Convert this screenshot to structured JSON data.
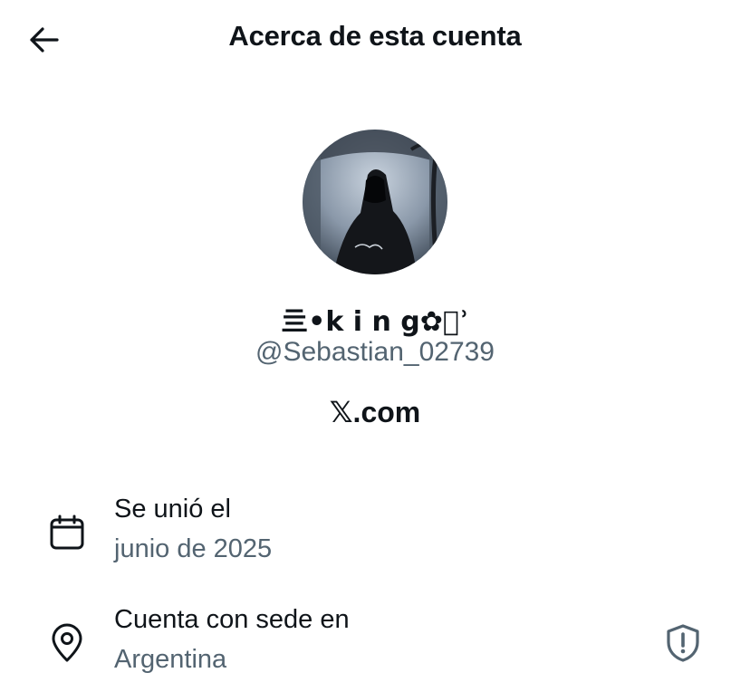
{
  "header": {
    "title": "Acerca de esta cuenta",
    "back_icon": "arrow-left-icon"
  },
  "profile": {
    "display_name": "亖•k i n g✿⃝ʾ",
    "handle": "@Sebastian_02739",
    "site": "𝕏.com"
  },
  "details": [
    {
      "icon": "calendar-icon",
      "label": "Se unió el",
      "value": "junio de 2025"
    },
    {
      "icon": "location-pin-icon",
      "label": "Cuenta con sede en",
      "value": "Argentina",
      "badge_icon": "shield-alert-icon"
    }
  ],
  "colors": {
    "text_primary": "#0f1419",
    "text_secondary": "#536471",
    "background": "#ffffff"
  }
}
